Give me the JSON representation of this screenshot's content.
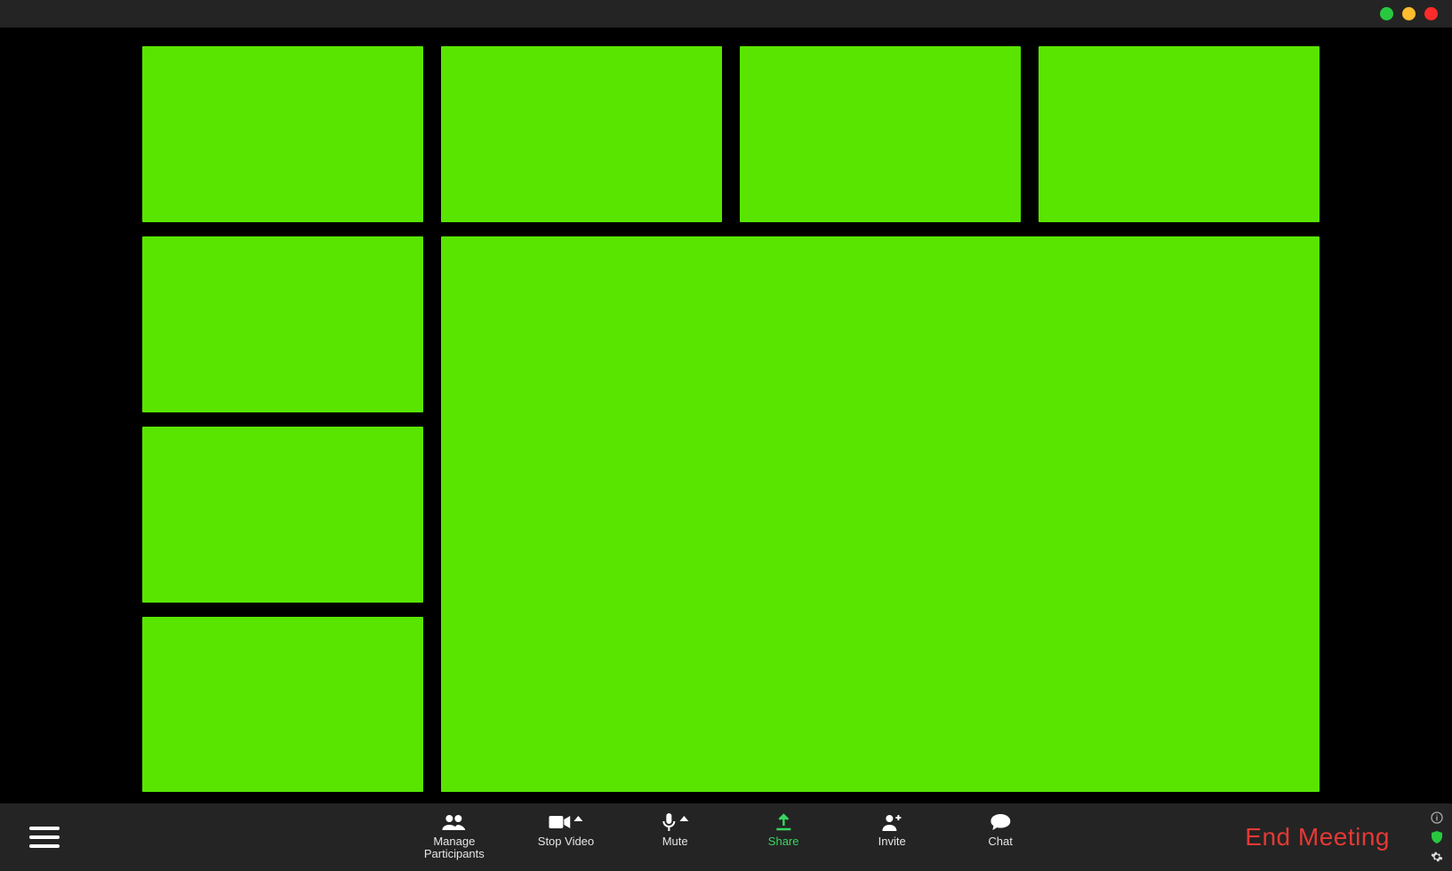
{
  "titlebar": {
    "traffic_lights": [
      "green",
      "yellow",
      "red"
    ]
  },
  "video_tile_color": "#59e500",
  "toolbar": {
    "manage_participants_label_line1": "Manage",
    "manage_participants_label_line2": "Participants",
    "stop_video_label": "Stop Video",
    "mute_label": "Mute",
    "share_label": "Share",
    "invite_label": "Invite",
    "chat_label": "Chat",
    "end_meeting_label": "End Meeting"
  },
  "colors": {
    "share_active": "#37d660",
    "end_meeting": "#e53935",
    "toolbar_bg": "#242424"
  }
}
